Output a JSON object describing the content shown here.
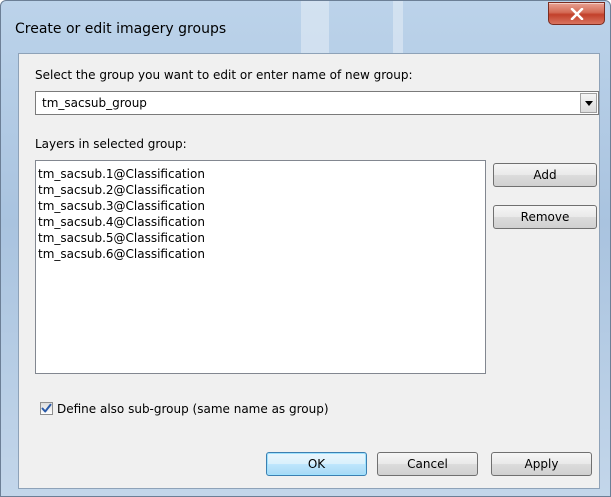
{
  "window": {
    "title": "Create or edit imagery groups",
    "close_glyph": "x"
  },
  "group_select": {
    "label": "Select the group you want to edit or enter name of new group:",
    "value": "tm_sacsub_group"
  },
  "layers": {
    "label": "Layers in selected group:",
    "items": [
      "tm_sacsub.1@Classification",
      "tm_sacsub.2@Classification",
      "tm_sacsub.3@Classification",
      "tm_sacsub.4@Classification",
      "tm_sacsub.5@Classification",
      "tm_sacsub.6@Classification"
    ],
    "add_label": "Add",
    "remove_label": "Remove"
  },
  "subgroup": {
    "label": "Define also sub-group (same name as group)",
    "checked": true
  },
  "footer": {
    "ok_label": "OK",
    "cancel_label": "Cancel",
    "apply_label": "Apply"
  },
  "colors": {
    "close_red": "#c2402a",
    "default_button_border": "#3c7fb1",
    "check_blue": "#2a5aa8"
  },
  "icons": {
    "close": "close-icon",
    "dropdown": "chevron-down-icon",
    "check": "checkmark-icon"
  }
}
